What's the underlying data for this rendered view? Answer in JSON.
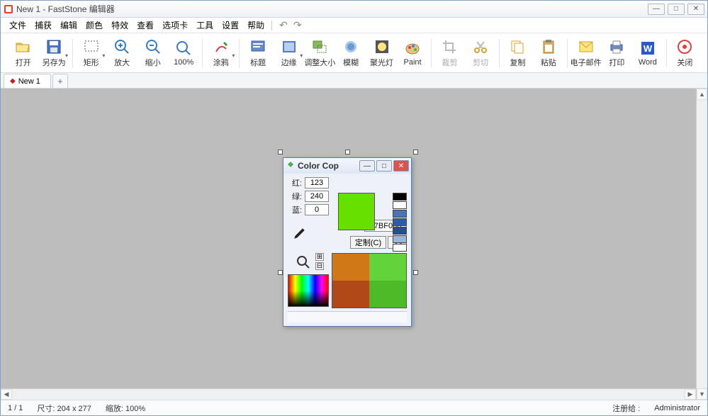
{
  "window": {
    "title": "New 1 - FastStone 编辑器"
  },
  "menus": [
    "文件",
    "捕获",
    "编辑",
    "颜色",
    "特效",
    "查看",
    "选项卡",
    "工具",
    "设置",
    "帮助"
  ],
  "toolbar": [
    {
      "label": "打开",
      "icon": "folder-open-icon"
    },
    {
      "label": "另存为",
      "icon": "save-icon"
    },
    {
      "label": "矩形",
      "icon": "rect-select-icon"
    },
    {
      "label": "放大",
      "icon": "zoom-in-icon"
    },
    {
      "label": "缩小",
      "icon": "zoom-out-icon"
    },
    {
      "label": "100%",
      "icon": "zoom-100-icon"
    },
    {
      "label": "涂鸦",
      "icon": "draw-icon"
    },
    {
      "label": "标题",
      "icon": "caption-icon"
    },
    {
      "label": "边缘",
      "icon": "edge-icon"
    },
    {
      "label": "调整大小",
      "icon": "resize-icon"
    },
    {
      "label": "模糊",
      "icon": "blur-icon"
    },
    {
      "label": "聚光灯",
      "icon": "spotlight-icon"
    },
    {
      "label": "Paint",
      "icon": "paint-icon"
    },
    {
      "label": "裁剪",
      "icon": "crop-icon",
      "dim": true
    },
    {
      "label": "剪切",
      "icon": "cut-icon",
      "dim": true
    },
    {
      "label": "复制",
      "icon": "copy-icon"
    },
    {
      "label": "粘贴",
      "icon": "paste-icon"
    },
    {
      "label": "电子邮件",
      "icon": "email-icon"
    },
    {
      "label": "打印",
      "icon": "print-icon"
    },
    {
      "label": "Word",
      "icon": "word-icon"
    },
    {
      "label": "关闭",
      "icon": "close-icon"
    }
  ],
  "tabs": [
    {
      "label": "New 1",
      "modified": true
    }
  ],
  "colorcop": {
    "title": "Color Cop",
    "labels": {
      "r": "红:",
      "g": "绿:",
      "b": "蓝:"
    },
    "r": "123",
    "g": "240",
    "b": "0",
    "hex": "#7BF000",
    "custom_btn": "定制(C)",
    "expand_btn": "<<",
    "swatches": [
      "#000000",
      "#ffffff",
      "#4a74b8",
      "#2d5ca8",
      "#264f8f",
      "#9ab6d8",
      "#ffffff"
    ]
  },
  "status": {
    "page": "1 / 1",
    "size_label": "尺寸:",
    "size": "204 x 277",
    "zoom_label": "缩放:",
    "zoom": "100%",
    "reg_label": "注册给 :",
    "reg_to": "Administrator"
  }
}
